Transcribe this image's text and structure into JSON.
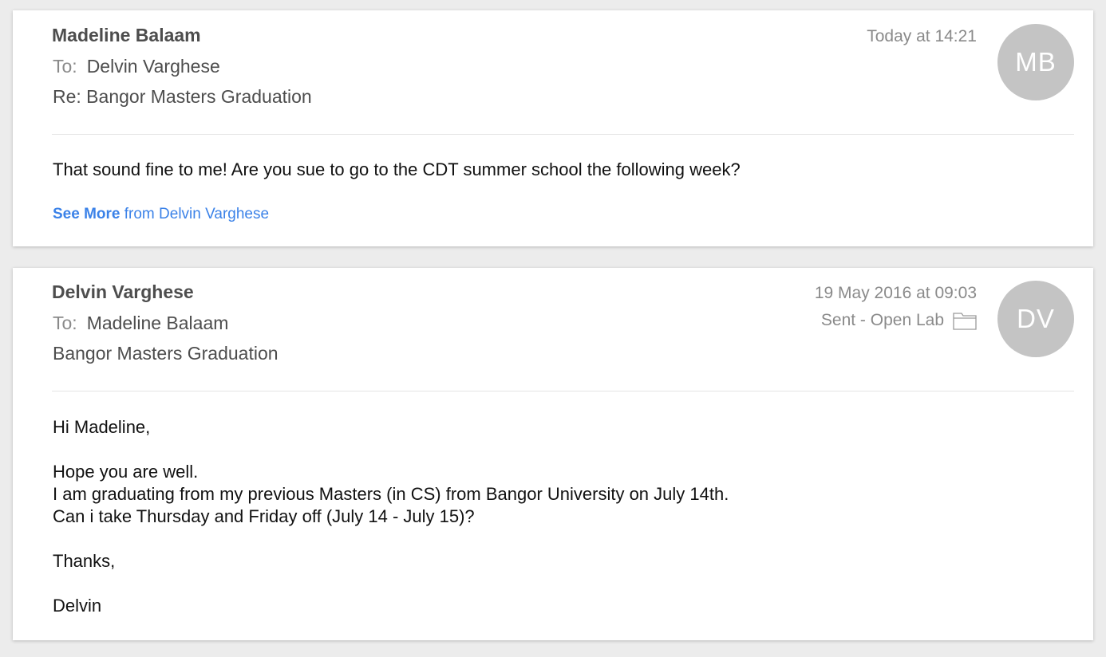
{
  "messages": [
    {
      "sender": "Madeline Balaam",
      "to_label": "To:",
      "to": "Delvin Varghese",
      "subject": "Re: Bangor Masters Graduation",
      "date": "Today at 14:21",
      "avatar_initials": "MB",
      "body": "That sound fine to me! Are you sue to go to the CDT summer school the following week?",
      "see_more_bold": "See More",
      "see_more_rest": " from Delvin Varghese"
    },
    {
      "sender": "Delvin Varghese",
      "to_label": "To:",
      "to": "Madeline Balaam",
      "subject": "Bangor Masters Graduation",
      "date": "19 May 2016 at 09:03",
      "mailbox": "Sent - Open Lab",
      "mailbox_icon": "folder-icon",
      "avatar_initials": "DV",
      "body_lines": [
        "Hi Madeline,",
        "",
        "Hope you are well.",
        "I am graduating from my previous Masters (in CS) from Bangor University on July 14th.",
        "Can i take Thursday and Friday off (July 14 - July 15)?",
        "",
        "Thanks,",
        "",
        "Delvin"
      ]
    }
  ],
  "colors": {
    "background": "#ececec",
    "card": "#ffffff",
    "avatar": "#c4c4c4",
    "link": "#3b82e8",
    "muted_text": "#8a8a8a",
    "header_text": "#4d4d4d"
  }
}
